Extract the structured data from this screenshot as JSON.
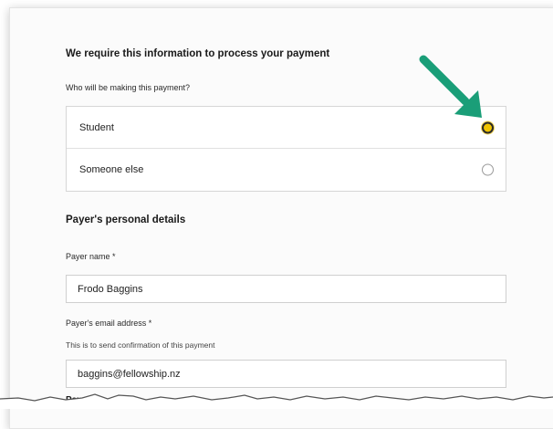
{
  "form": {
    "heading": "We require this information to process your payment",
    "question": "Who will be making this payment?",
    "options": [
      {
        "label": "Student",
        "selected": true
      },
      {
        "label": "Someone else",
        "selected": false
      }
    ],
    "section_title": "Payer's personal details",
    "payer_name": {
      "label": "Payer name *",
      "value": "Frodo Baggins"
    },
    "payer_email": {
      "label": "Payer's email address *",
      "help": "This is to send confirmation of this payment",
      "value": "baggins@fellowship.nz"
    },
    "cut_off_label": "Payer's"
  },
  "colors": {
    "arrow": "#1a9e78",
    "radio_selected": "#f0c400"
  },
  "icons": {
    "annotation": "arrow-pointer-icon"
  }
}
